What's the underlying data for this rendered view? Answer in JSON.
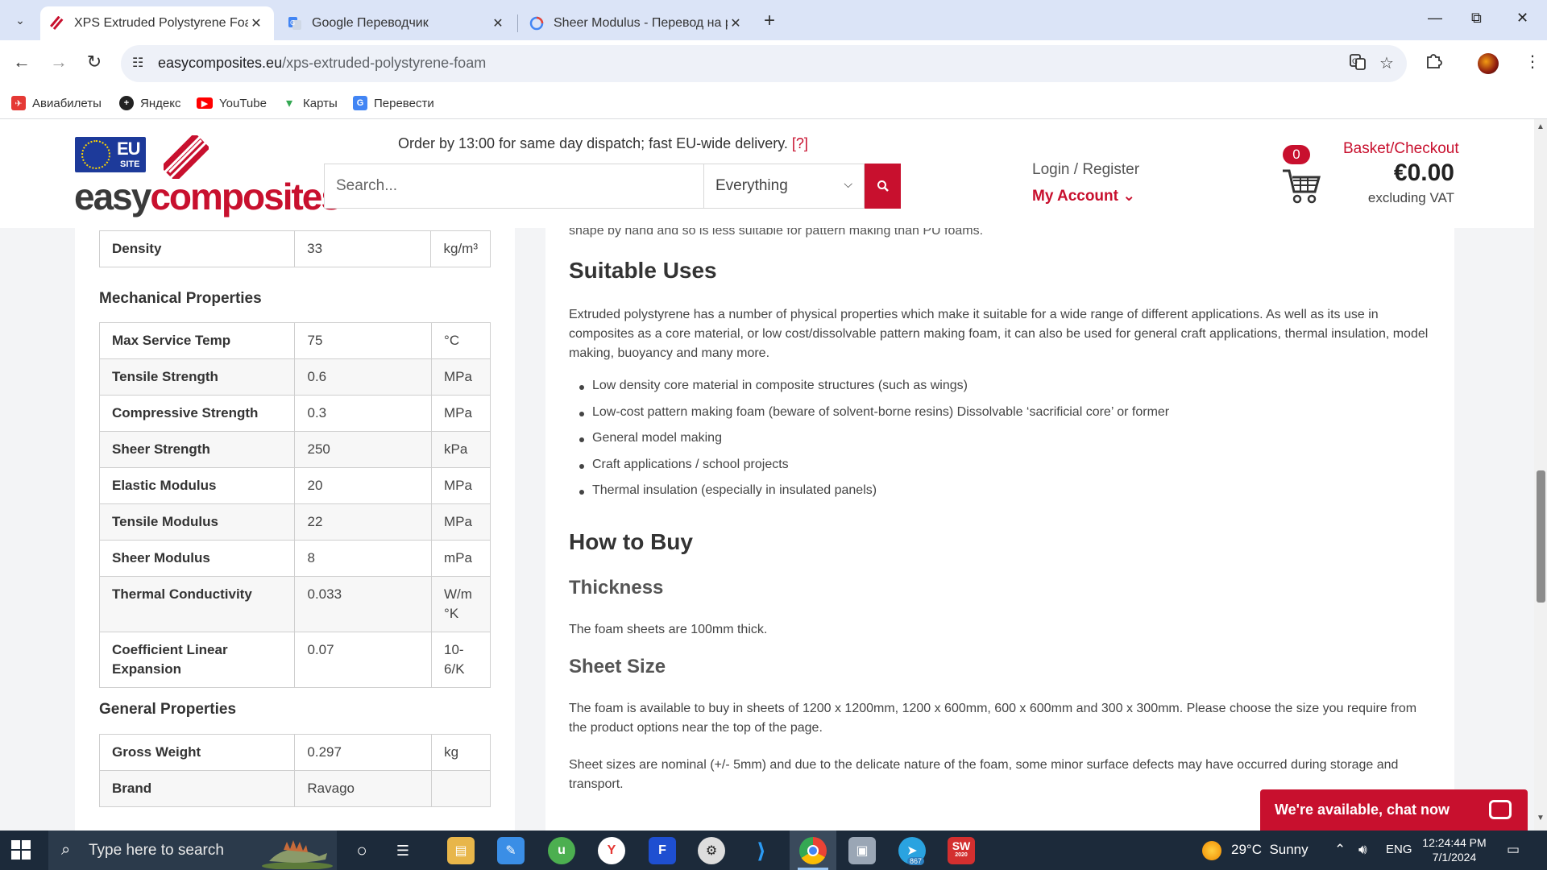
{
  "browser": {
    "tabs": [
      {
        "title": "XPS Extruded Polystyrene Foam",
        "active": true
      },
      {
        "title": "Google Переводчик",
        "active": false
      },
      {
        "title": "Sheer Modulus - Перевод на р",
        "active": false
      }
    ],
    "url_host": "easycomposites.eu",
    "url_path": "/xps-extruded-polystyrene-foam",
    "bookmarks": [
      "Авиабилеты",
      "Яндекс",
      "YouTube",
      "Карты",
      "Перевести"
    ]
  },
  "header": {
    "logo_eu": "EU",
    "logo_site": "SITE",
    "logo_easy": "easy",
    "logo_composites": "composites",
    "promo_text": "Order by 13:00 for same day dispatch; fast EU-wide delivery.",
    "promo_help": "[?]",
    "search_placeholder": "Search...",
    "search_scope": "Everything",
    "login_text": "Login / Register",
    "account_text": "My Account",
    "cart_count": "0",
    "basket_label": "Basket/Checkout",
    "basket_total": "€0.00",
    "basket_vat": "excluding VAT"
  },
  "specs": {
    "density": {
      "name": "Density",
      "value": "33",
      "unit": "kg/m³"
    },
    "mechanical_heading": "Mechanical Properties",
    "mechanical": [
      {
        "name": "Max Service Temp",
        "value": "75",
        "unit": "°C"
      },
      {
        "name": "Tensile Strength",
        "value": "0.6",
        "unit": "MPa"
      },
      {
        "name": "Compressive Strength",
        "value": "0.3",
        "unit": "MPa"
      },
      {
        "name": "Sheer Strength",
        "value": "250",
        "unit": "kPa"
      },
      {
        "name": "Elastic Modulus",
        "value": "20",
        "unit": "MPa"
      },
      {
        "name": "Tensile Modulus",
        "value": "22",
        "unit": "MPa"
      },
      {
        "name": "Sheer Modulus",
        "value": "8",
        "unit": "mPa"
      },
      {
        "name": "Thermal Conductivity",
        "value": "0.033",
        "unit": "W/m °K"
      },
      {
        "name": "Coefficient Linear Expansion",
        "value": "0.07",
        "unit": "10-6/K"
      }
    ],
    "general_heading": "General Properties",
    "general": [
      {
        "name": "Gross Weight",
        "value": "0.297",
        "unit": "kg"
      },
      {
        "name": "Brand",
        "value": "Ravago",
        "unit": ""
      }
    ]
  },
  "article": {
    "cut_line": "shape by hand and so is less suitable for pattern making than PU foams.",
    "uses_heading": "Suitable Uses",
    "uses_intro": "Extruded polystyrene has a number of physical properties which make it suitable for a wide range of different applications. As well as its use in composites as a core material, or low cost/dissolvable pattern making foam, it can also be used for general craft applications, thermal insulation, model making, buoyancy and many more.",
    "uses_list": [
      "Low density core material in composite structures (such as wings)",
      "Low-cost pattern making foam (beware of solvent-borne resins) Dissolvable ‘sacrificial core’ or former",
      "General model making",
      "Craft applications / school projects",
      "Thermal insulation (especially in insulated panels)"
    ],
    "buy_heading": "How to Buy",
    "thickness_heading": "Thickness",
    "thickness_text": "The foam sheets are 100mm thick.",
    "size_heading": "Sheet Size",
    "size_text": "The foam is available to buy in sheets of 1200 x 1200mm, 1200 x 600mm, 600 x 600mm and 300 x 300mm. Please choose the size you require from the product options near the top of the page.",
    "nominal_text": "Sheet sizes are nominal (+/- 5mm) and due to the delicate nature of the foam, some minor surface defects may have occurred during storage and transport."
  },
  "chat": {
    "label": "We're available, chat now"
  },
  "taskbar": {
    "search_placeholder": "Type here to search",
    "weather_temp": "29°C",
    "weather_desc": "Sunny",
    "language": "ENG",
    "time": "12:24:44 PM",
    "date": "7/1/2024",
    "telegram_badge": "867",
    "sw_label": "SW",
    "sw_year": "2020"
  },
  "colors": {
    "brand_red": "#c8102e",
    "eu_blue": "#1d3a9a",
    "taskbar": "#1c2a3a"
  }
}
